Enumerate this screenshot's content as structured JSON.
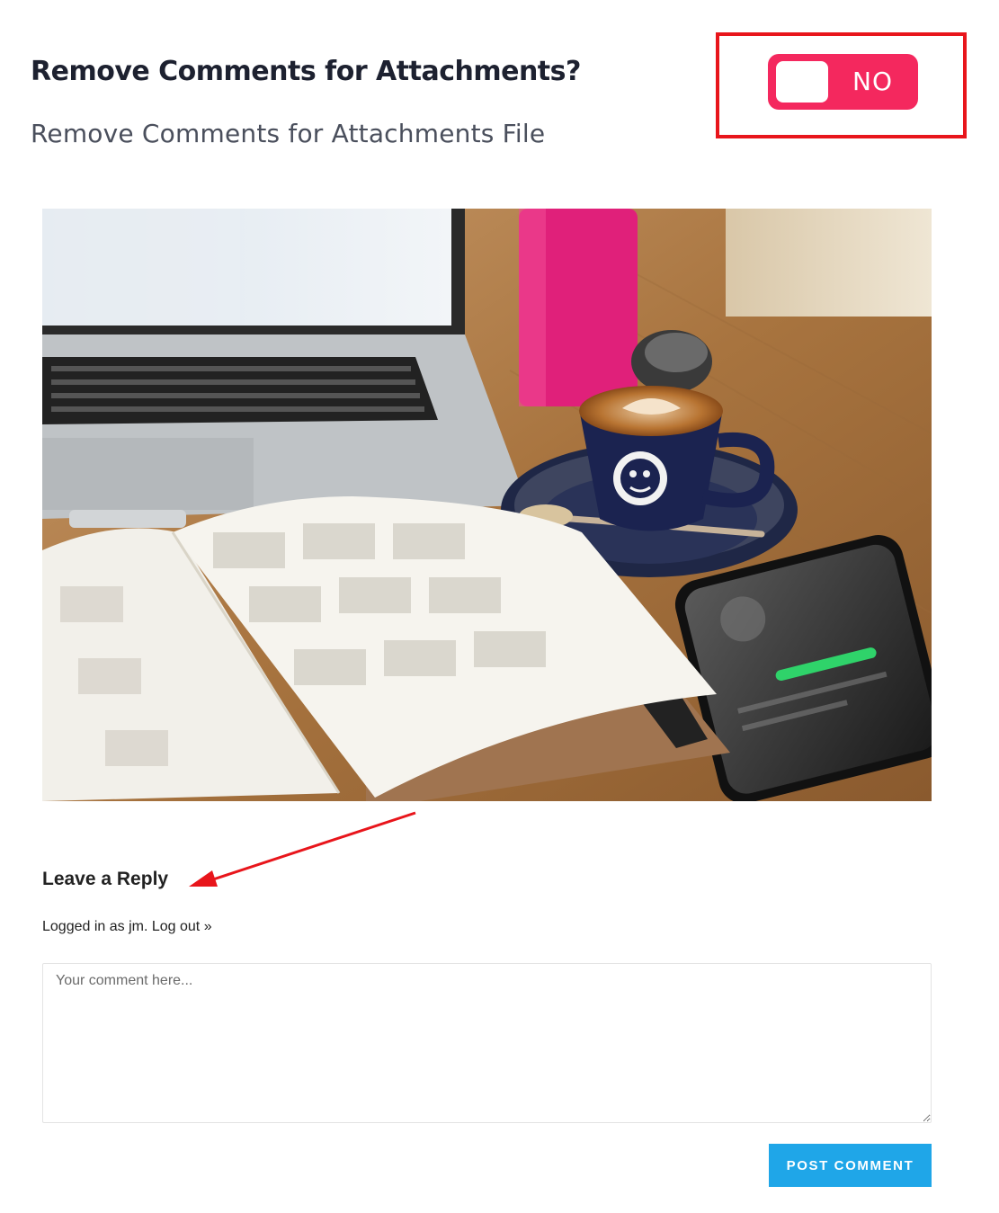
{
  "setting": {
    "title": "Remove Comments for Attachments?",
    "description": "Remove Comments for Attachments File",
    "toggle_label": "NO",
    "toggle_on": false
  },
  "colors": {
    "toggle_bg": "#f4285e",
    "highlight_border": "#e8151b",
    "annotation_arrow": "#e8151b",
    "post_button_bg": "#1fa6e8"
  },
  "image": {
    "icon": "photo-laptop-coffee-notebook-phone"
  },
  "reply": {
    "title": "Leave a Reply",
    "logged_in_prefix": "Logged in as jm.",
    "logout_label": "Log out »",
    "comment_placeholder": "Your comment here...",
    "comment_value": "",
    "post_button_label": "POST COMMENT"
  }
}
